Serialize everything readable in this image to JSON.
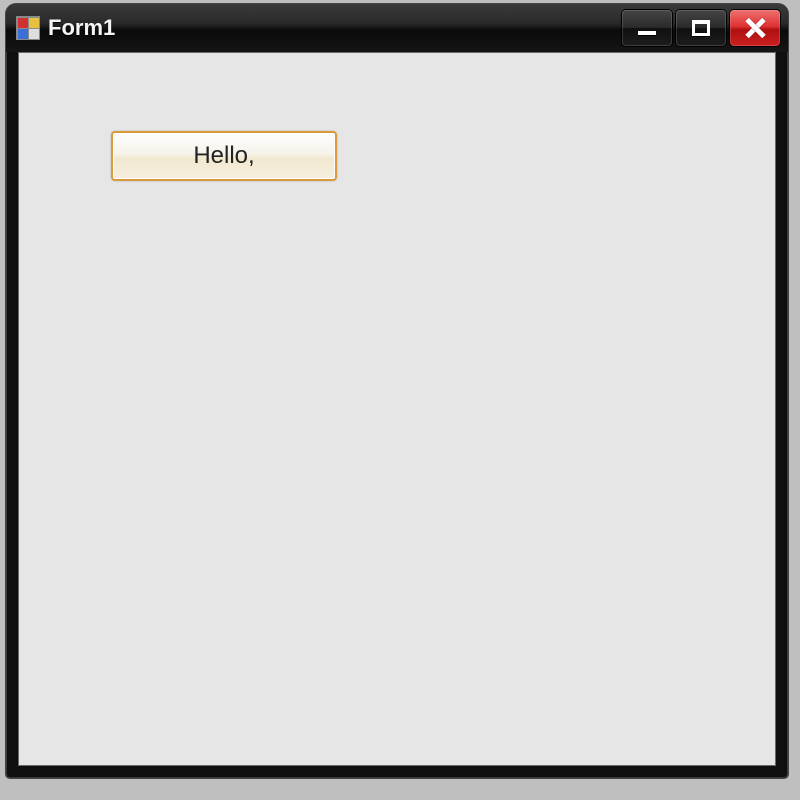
{
  "window": {
    "title": "Form1"
  },
  "controls": {
    "minimize_label": "Minimize",
    "maximize_label": "Maximize",
    "close_label": "Close"
  },
  "form": {
    "button1_label": "Hello,"
  }
}
